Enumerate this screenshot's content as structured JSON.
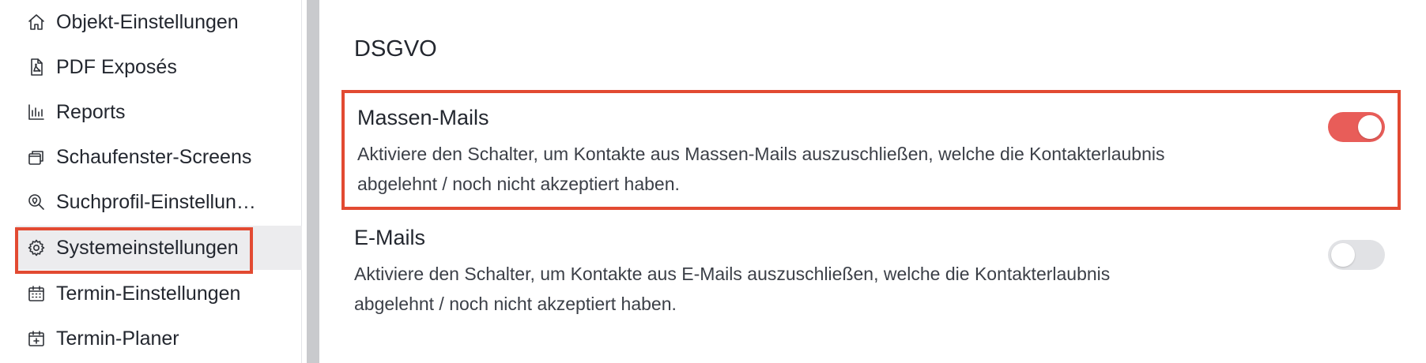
{
  "sidebar": {
    "items": [
      {
        "label": "Objekt-Einstellungen",
        "icon": "home-icon"
      },
      {
        "label": "PDF Exposés",
        "icon": "pdf-file-icon"
      },
      {
        "label": "Reports",
        "icon": "bar-chart-icon"
      },
      {
        "label": "Schaufenster-Screens",
        "icon": "screens-icon"
      },
      {
        "label": "Suchprofil-Einstellun…",
        "icon": "search-location-icon"
      },
      {
        "label": "Systemeinstellungen",
        "icon": "gear-icon",
        "active": true
      },
      {
        "label": "Termin-Einstellungen",
        "icon": "calendar-icon"
      },
      {
        "label": "Termin-Planer",
        "icon": "calendar-plus-icon"
      }
    ]
  },
  "main": {
    "section_title": "DSGVO",
    "settings": [
      {
        "title": "Massen-Mails",
        "description": "Aktiviere den Schalter, um Kontakte aus Massen-Mails auszuschließen, welche die Kontakterlaubnis abgelehnt / noch nicht akzeptiert haben.",
        "enabled": true,
        "highlighted": true
      },
      {
        "title": "E-Mails",
        "description": "Aktiviere den Schalter, um Kontakte aus E-Mails auszuschließen, welche die Kontakterlaubnis abgelehnt / noch nicht akzeptiert haben.",
        "enabled": false,
        "highlighted": false
      }
    ]
  },
  "colors": {
    "accent": "#e85d59",
    "highlight_border": "#e24a32",
    "active_item_bg": "#ececee"
  }
}
